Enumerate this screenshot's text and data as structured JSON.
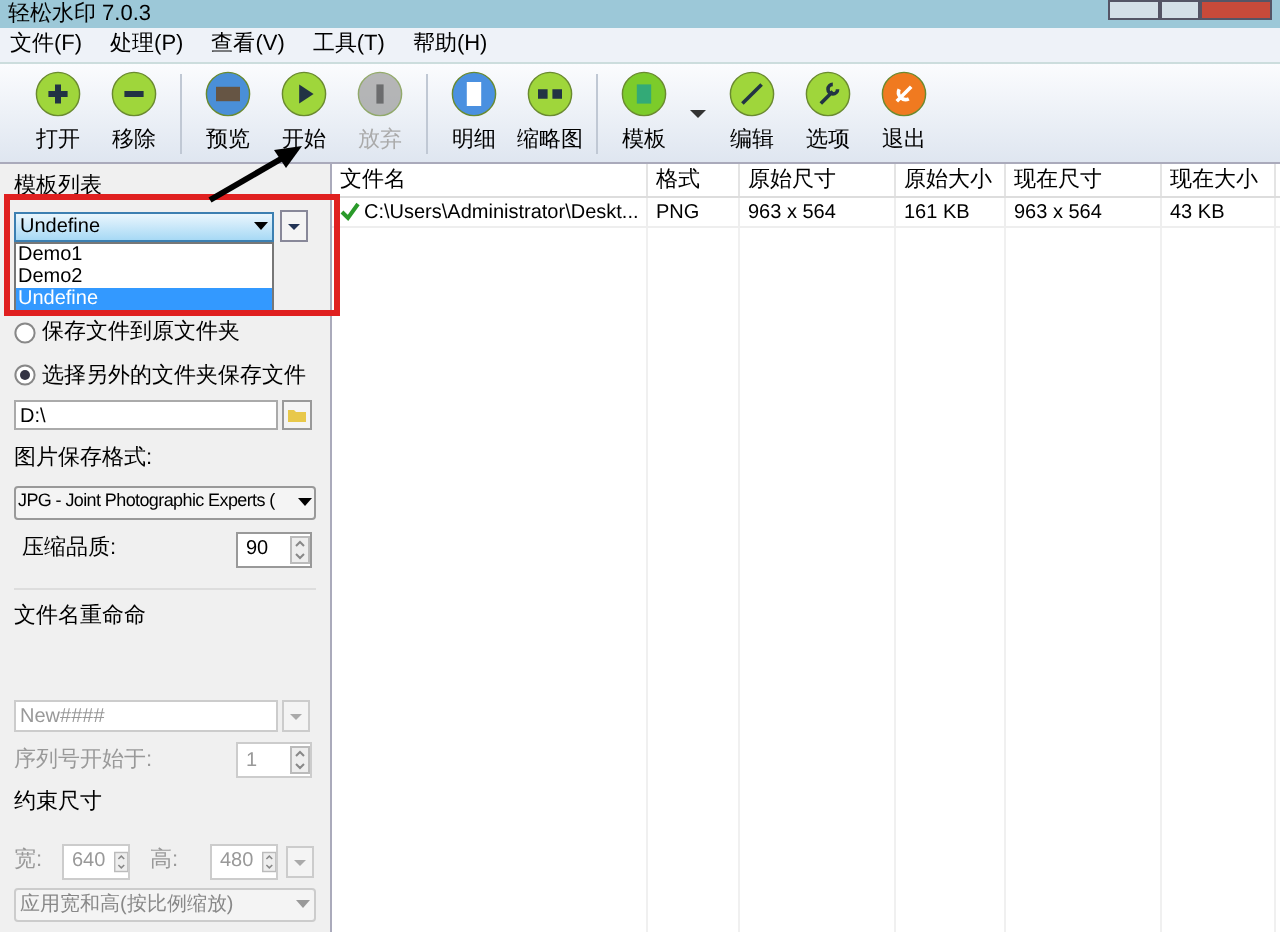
{
  "window": {
    "title": "轻松水印 7.0.3"
  },
  "menu": [
    "文件(F)",
    "处理(P)",
    "查看(V)",
    "工具(T)",
    "帮助(H)"
  ],
  "toolbar": [
    {
      "label": "打开",
      "kind": "plus",
      "disabled": false
    },
    {
      "label": "移除",
      "kind": "minus",
      "disabled": false
    },
    {
      "kind": "separator"
    },
    {
      "label": "预览",
      "kind": "preview",
      "disabled": false
    },
    {
      "label": "开始",
      "kind": "play",
      "disabled": false
    },
    {
      "label": "放弃",
      "kind": "stop",
      "disabled": true
    },
    {
      "kind": "separator"
    },
    {
      "label": "明细",
      "kind": "details",
      "disabled": false
    },
    {
      "label": "缩略图",
      "kind": "thumbs",
      "disabled": false
    },
    {
      "kind": "separator"
    },
    {
      "label": "模板",
      "kind": "template",
      "disabled": false
    },
    {
      "kind": "caret"
    },
    {
      "label": "编辑",
      "kind": "edit",
      "disabled": false
    },
    {
      "label": "选项",
      "kind": "options",
      "disabled": false
    },
    {
      "label": "退出",
      "kind": "exit",
      "disabled": false
    }
  ],
  "sidebar": {
    "template_label": "模板列表",
    "template_value": "Undefine",
    "template_options": [
      {
        "label": "Demo1",
        "selected": false
      },
      {
        "label": "Demo2",
        "selected": false
      },
      {
        "label": "Undefine",
        "selected": true
      }
    ],
    "save_options": [
      {
        "label": "保存文件到原文件夹",
        "selected": false
      },
      {
        "label": "选择另外的文件夹保存文件",
        "selected": true
      }
    ],
    "folder": "D:\\",
    "format_label": "图片保存格式:",
    "format_value": "JPG - Joint Photographic Experts (",
    "quality_label": "压缩品质:",
    "quality_value": "90",
    "rename": {
      "title": "文件名重命命",
      "pattern": "New####",
      "start_label": "序列号开始于:",
      "start_value": "1",
      "disabled": true
    },
    "resize": {
      "title": "约束尺寸",
      "width_label": "宽:",
      "width_value": "640",
      "height_label": "高:",
      "height_value": "480",
      "mode": "应用宽和高(按比例缩放)",
      "disabled": true
    }
  },
  "table": {
    "columns": [
      "文件名",
      "格式",
      "原始尺寸",
      "原始大小",
      "现在尺寸",
      "现在大小"
    ],
    "rows": [
      {
        "done": true,
        "cells": [
          "C:\\Users\\Administrator\\Deskt...",
          "PNG",
          "963 x 564",
          "161 KB",
          "963 x 564",
          "43 KB"
        ]
      }
    ]
  }
}
